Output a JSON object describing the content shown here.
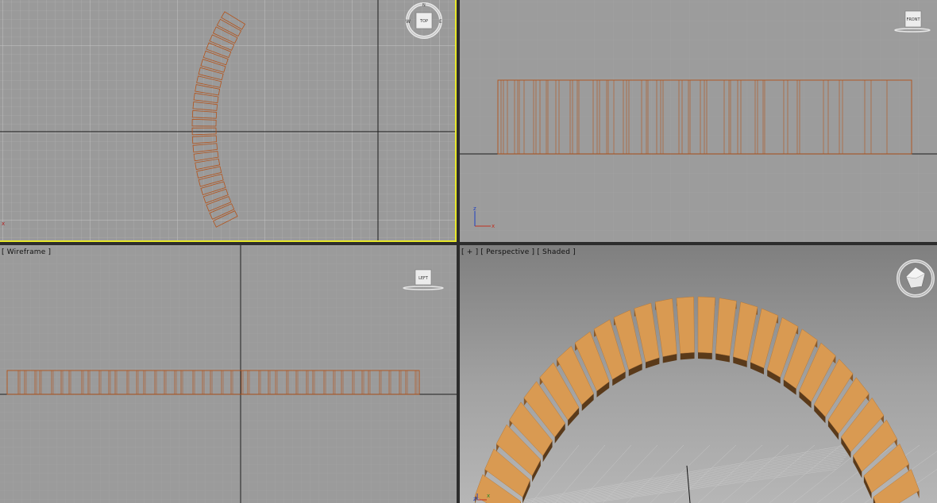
{
  "viewports": {
    "top": {
      "label": "",
      "navcube_face": "TOP",
      "compass": {
        "n": "N",
        "w": "W",
        "e": "E"
      },
      "axis_x": "x"
    },
    "front": {
      "label": "",
      "navcube_face": "FRONT",
      "axis_x": "x",
      "axis_z": "z"
    },
    "left": {
      "label": "[ Wireframe ]",
      "navcube_face": "LEFT"
    },
    "perspective": {
      "label": "[ + ] [ Perspective ] [ Shaded ]",
      "axis_x": "x",
      "axis_z": "z"
    }
  },
  "colors": {
    "active_border": "#e8e82a",
    "wireframe": "#b4531a",
    "plank_fill": "#d99a52",
    "grid_line": "#b0b0b0",
    "axis_line": "#202020"
  },
  "icons": [
    "navcube-icon",
    "viewcube-ring-icon",
    "axis-tripod-icon"
  ]
}
